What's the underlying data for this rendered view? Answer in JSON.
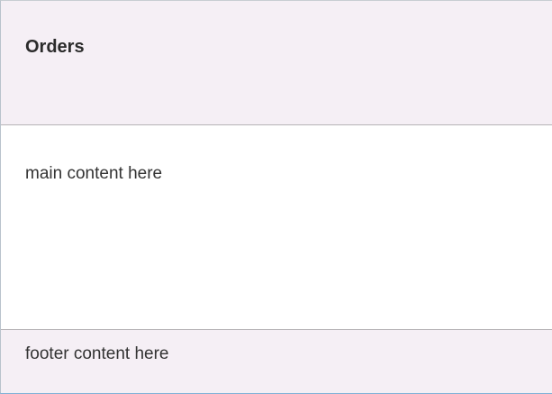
{
  "header": {
    "title": "Orders"
  },
  "main": {
    "text": "main content here"
  },
  "footer": {
    "text": "footer content here"
  },
  "colors": {
    "panel_background": "#f5eff5",
    "content_background": "#ffffff",
    "divider": "#b6b3b6",
    "bottom_accent": "#7fb1d6",
    "text": "#333333"
  }
}
